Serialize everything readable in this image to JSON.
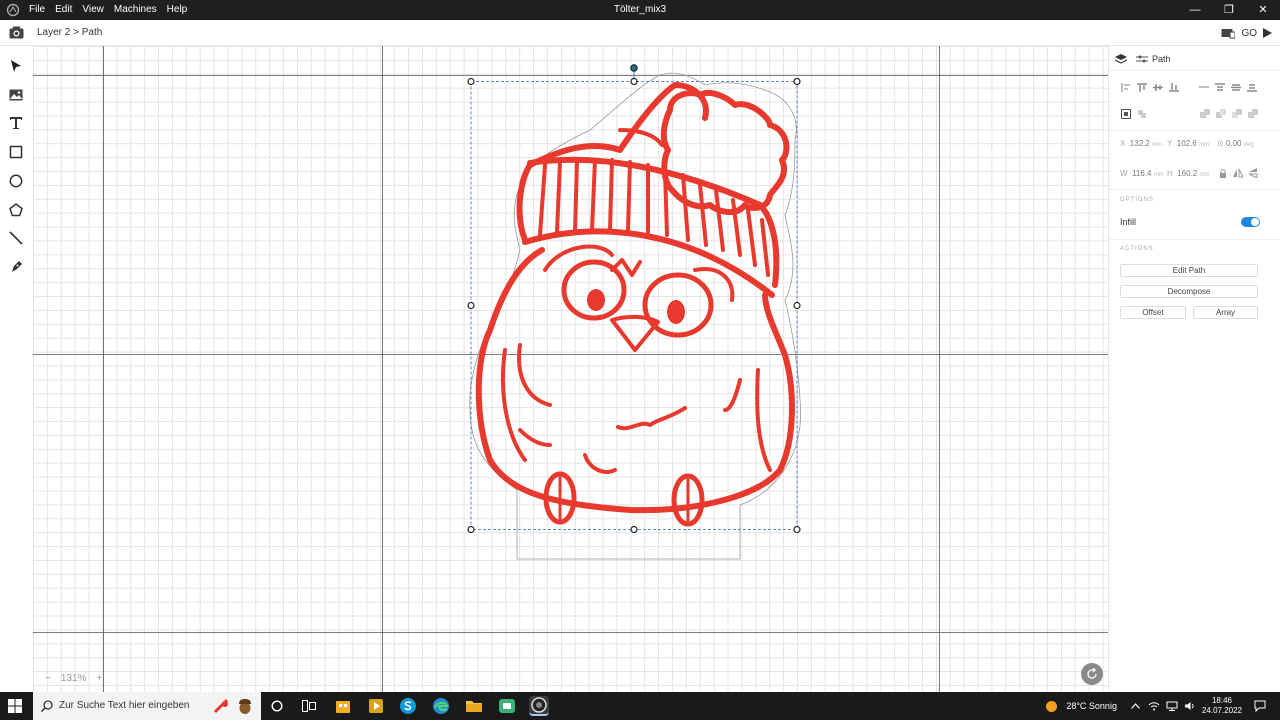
{
  "window": {
    "title": "Tölter_mix3",
    "menu": [
      "File",
      "Edit",
      "View",
      "Machines",
      "Help"
    ],
    "controls": [
      "—",
      "❐",
      "✕"
    ]
  },
  "toolbar": {
    "breadcrumb": "Layer 2 > Path",
    "go_label": "GO"
  },
  "tools": [
    "select-tool",
    "image-tool",
    "text-tool",
    "rectangle-tool",
    "ellipse-tool",
    "polygon-tool",
    "line-tool",
    "pen-tool"
  ],
  "canvas": {
    "zoom_level": "131%",
    "zoom_minus": "−",
    "zoom_plus": "+",
    "artwork_color": "#e8392e"
  },
  "panel": {
    "title": "Path",
    "x_label": "X",
    "x_value": "132.2",
    "x_unit": "mm",
    "y_label": "Y",
    "y_value": "102.6",
    "y_unit": "mm",
    "rot_value": "0.00",
    "rot_unit": "deg",
    "w_label": "W",
    "w_value": "116.4",
    "w_unit": "mm",
    "h_label": "H",
    "h_value": "160.2",
    "h_unit": "mm",
    "options_header": "OPTIONS",
    "infill_label": "Infill",
    "infill_on": true,
    "actions_header": "ACTIONS",
    "edit_path": "Edit Path",
    "decompose": "Decompose",
    "offset": "Offset",
    "array": "Array"
  },
  "taskbar": {
    "search_placeholder": "Zur Suche Text hier eingeben",
    "weather": "28°C Sonnig",
    "time": "18:46",
    "date": "24.07.2022"
  }
}
